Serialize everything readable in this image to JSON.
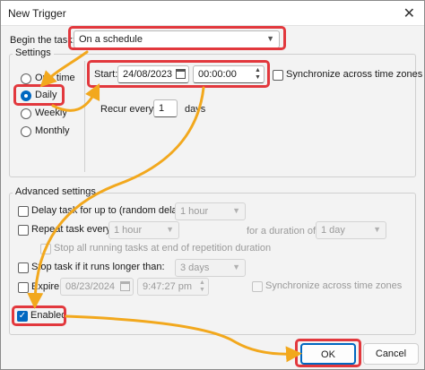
{
  "window": {
    "title": "New Trigger",
    "close_glyph": "✕"
  },
  "begin_task": {
    "label": "Begin the task:",
    "value": "On a schedule"
  },
  "settings": {
    "group_title": "Settings",
    "schedule_options": [
      {
        "label": "One time",
        "selected": false
      },
      {
        "label": "Daily",
        "selected": true
      },
      {
        "label": "Weekly",
        "selected": false
      },
      {
        "label": "Monthly",
        "selected": false
      }
    ],
    "start_label": "Start:",
    "start_date": "24/08/2023",
    "start_time": "00:00:00",
    "sync_label": "Synchronize across time zones",
    "recur_label": "Recur every:",
    "recur_value": "1",
    "recur_unit": "days"
  },
  "advanced": {
    "group_title": "Advanced settings",
    "delay_label": "Delay task for up to (random delay):",
    "delay_value": "1 hour",
    "repeat_label": "Repeat task every:",
    "repeat_value": "1 hour",
    "duration_label": "for a duration of:",
    "duration_value": "1 day",
    "stop_all_label": "Stop all running tasks at end of repetition duration",
    "stop_label": "Stop task if it runs longer than:",
    "stop_value": "3 days",
    "expire_label": "Expire:",
    "expire_date": "08/23/2024",
    "expire_time": "9:47:27 pm",
    "expire_sync_label": "Synchronize across time zones",
    "enabled_label": "Enabled",
    "enabled_checked": true
  },
  "buttons": {
    "ok": "OK",
    "cancel": "Cancel"
  },
  "colors": {
    "accent": "#0067c0",
    "highlight_red": "#e2383d",
    "arrow_orange": "#f2a81d"
  }
}
